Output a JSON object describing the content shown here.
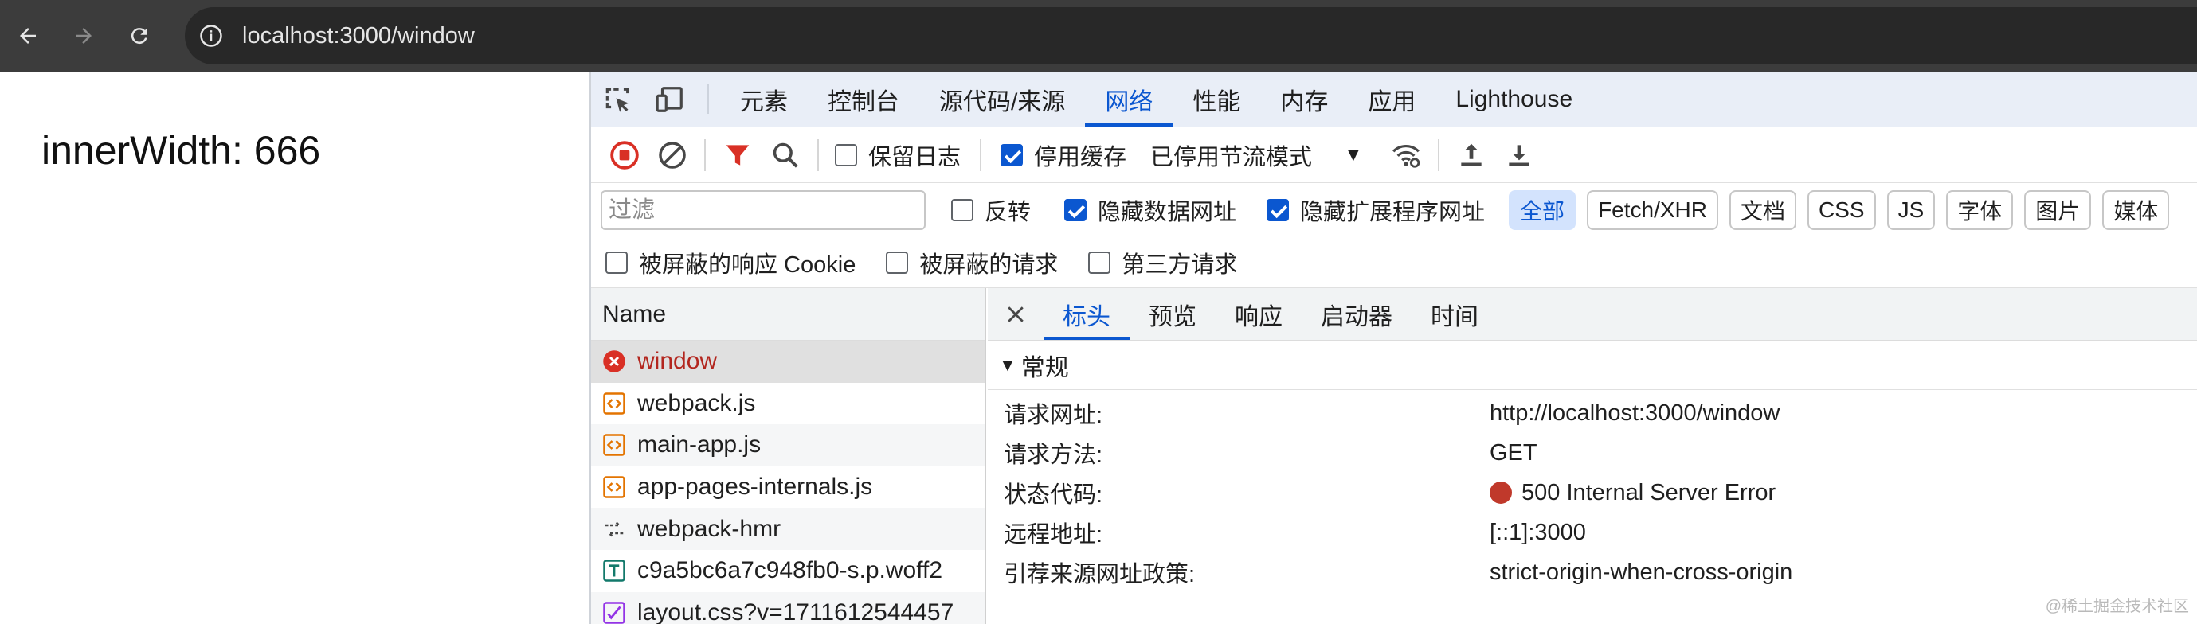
{
  "browser": {
    "url": "localhost:3000/window",
    "icons": {
      "back": "arrow-left-icon",
      "forward": "arrow-right-icon",
      "reload": "reload-icon",
      "info": "info-icon"
    }
  },
  "page": {
    "text": "innerWidth: 666"
  },
  "devtools": {
    "tabs": [
      "元素",
      "控制台",
      "源代码/来源",
      "网络",
      "性能",
      "内存",
      "应用",
      "Lighthouse"
    ],
    "active_tab": "网络",
    "toolbar": {
      "preserve_log": "保留日志",
      "disable_cache": "停用缓存",
      "throttle": "已停用节流模式"
    },
    "filter": {
      "placeholder": "过滤",
      "invert": "反转",
      "hide_data_urls": "隐藏数据网址",
      "hide_extension_urls": "隐藏扩展程序网址",
      "types": [
        "全部",
        "Fetch/XHR",
        "文档",
        "CSS",
        "JS",
        "字体",
        "图片",
        "媒体"
      ]
    },
    "filter2": {
      "blocked_cookies": "被屏蔽的响应 Cookie",
      "blocked_requests": "被屏蔽的请求",
      "third_party": "第三方请求"
    },
    "requests": {
      "header": "Name",
      "rows": [
        {
          "name": "window",
          "icon": "error-icon"
        },
        {
          "name": "webpack.js",
          "icon": "script-icon"
        },
        {
          "name": "main-app.js",
          "icon": "script-icon"
        },
        {
          "name": "app-pages-internals.js",
          "icon": "script-icon"
        },
        {
          "name": "webpack-hmr",
          "icon": "websocket-icon"
        },
        {
          "name": "c9a5bc6a7c948fb0-s.p.woff2",
          "icon": "font-icon"
        },
        {
          "name": "layout.css?v=1711612544457",
          "icon": "stylesheet-icon"
        }
      ]
    },
    "detail": {
      "tabs": [
        "标头",
        "预览",
        "响应",
        "启动器",
        "时间"
      ],
      "section": "常规",
      "fields": [
        {
          "key": "请求网址:",
          "value": "http://localhost:3000/window"
        },
        {
          "key": "请求方法:",
          "value": "GET"
        },
        {
          "key": "状态代码:",
          "value": "500 Internal Server Error"
        },
        {
          "key": "远程地址:",
          "value": "[::1]:3000"
        },
        {
          "key": "引荐来源网址政策:",
          "value": "strict-origin-when-cross-origin"
        }
      ]
    },
    "watermark": "@稀土掘金技术社区",
    "colors": {
      "accent": "#0b57d0",
      "error": "#c0392b"
    }
  }
}
